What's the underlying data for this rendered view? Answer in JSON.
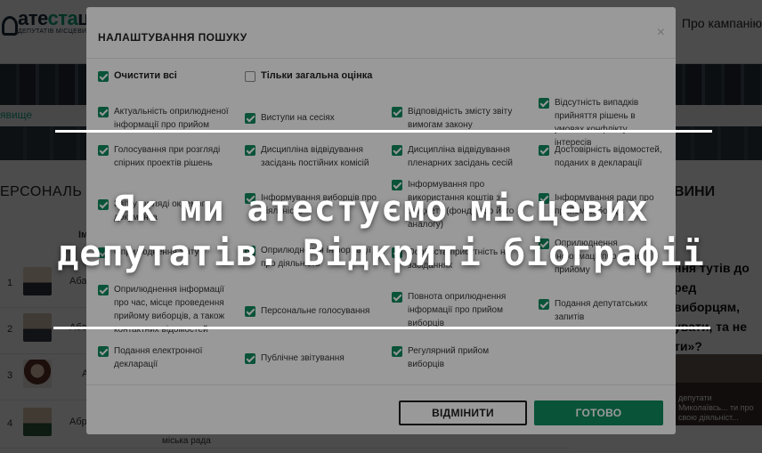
{
  "background": {
    "logo": {
      "title_dark": "ате",
      "title_accent": "ста",
      "title_rest": "ц",
      "subtitle": "ДЕПУТАТІВ МІСЦЕВИХ Р"
    },
    "nav": [
      "и",
      "Про кампанію"
    ],
    "breadcrumb": "явище",
    "section_left": "ЕРСОНАЛЬ",
    "section_right": "ВИНИ",
    "column_header": "Ім'я",
    "rows": [
      {
        "num": "1",
        "name": "Аба"
      },
      {
        "num": "2",
        "name": "Або"
      },
      {
        "num": "3",
        "name": "А"
      },
      {
        "num": "4",
        "name": "Абра"
      }
    ],
    "row_council": "міська рада",
    "news_text": "ння тутів до ред виборцям, увати, та не ти»?",
    "news_caption": "депутати Миколаївсь... ти про свою діяльніст..."
  },
  "modal": {
    "title": "НАЛАШТУВАННЯ ПОШУКУ",
    "close_glyph": "×",
    "clear_all": "Очистити всі",
    "only_overall": "Тільки загальна оцінка",
    "options": [
      "Актуальність оприлюдненої інформації про прийом",
      "Виступи на сесіях",
      "Відповідність змісту звіту вимогам закону",
      "Відсутність випадків прийняття рішень в умовах конфлікту інтересів",
      "Голосування при розгляді спірних проектів рішень",
      "Дисципліна відвідування засідань постійних комісій",
      "Дисципліна відвідування пленарних засідань сесій",
      "Достовірність відомостей, поданих в декларації",
      "Звіт у вигляді окремого документа",
      "Інформування виборців про діяльність",
      "Інформування про використання коштів з бюджету (фонду або його аналогу)",
      "Інформування ради про прийом виборців",
      "Оприлюднення звіту",
      "Оприлюднення інформації про діяльність",
      "Особиста присутність на засіданнях",
      "Оприлюднення інформації про місце прийому",
      "Оприлюднення інформації про час, місце проведення прийому виборців, а також контактних відомостей",
      "Персональне голосування",
      "Повнота оприлюднення інформації про прийом виборців",
      "Подання депутатських запитів",
      "Подання електронної декларації",
      "Публічне звітування",
      "Регулярний прийом виборців"
    ],
    "cancel_label": "ВІДМІНИТИ",
    "done_label": "ГОТОВО"
  },
  "headline": {
    "line1": "Як ми атестуємо місцевих",
    "line2": "депутатів. Відкриті біографії"
  },
  "colors": {
    "accent": "#0f8a5f",
    "logo_accent": "#0fa47a",
    "dark": "#1b2a3a"
  },
  "icons": [
    "check-icon",
    "close-icon",
    "logo-icon"
  ]
}
